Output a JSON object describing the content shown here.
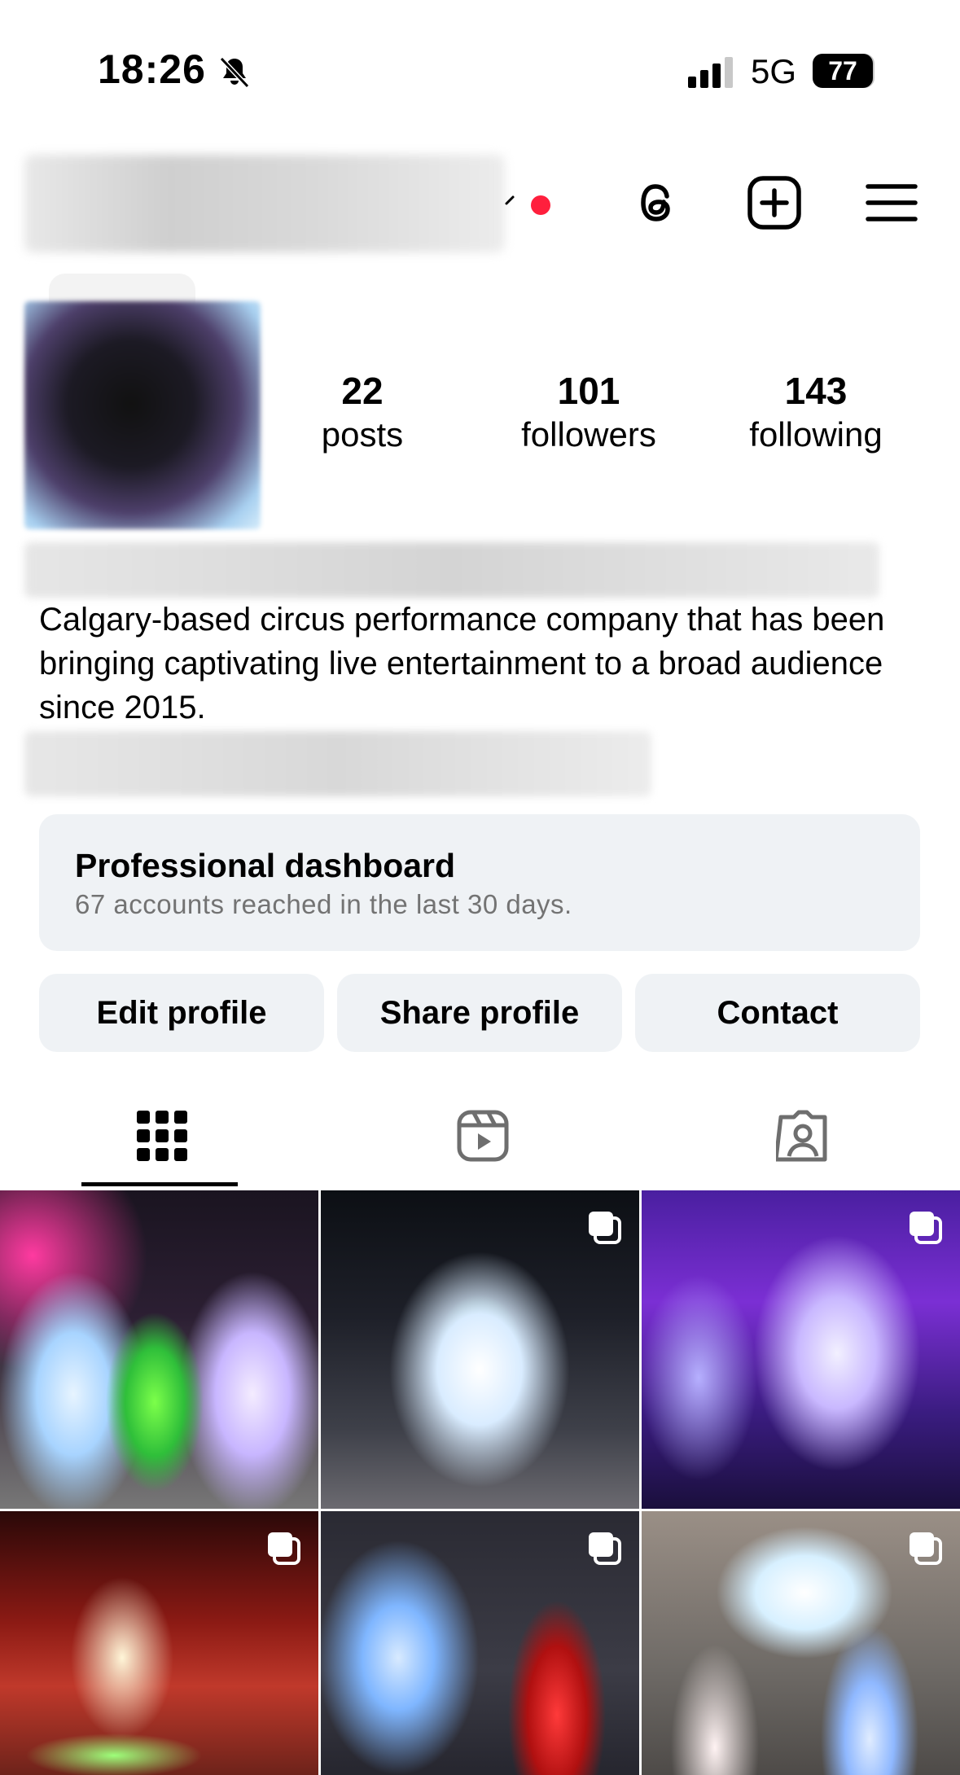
{
  "status_bar": {
    "time": "18:26",
    "network": "5G",
    "battery": "77"
  },
  "header": {
    "icons": [
      "threads-icon",
      "create-icon",
      "menu-icon"
    ]
  },
  "profile": {
    "stats": [
      {
        "value": "22",
        "label": "posts"
      },
      {
        "value": "101",
        "label": "followers"
      },
      {
        "value": "143",
        "label": "following"
      }
    ],
    "bio": "Calgary-based circus performance company that has been bringing captivating live entertainment to a broad audience since 2015."
  },
  "dashboard": {
    "title": "Professional dashboard",
    "subtitle": "67 accounts reached in the last 30 days."
  },
  "actions": {
    "edit": "Edit profile",
    "share": "Share profile",
    "contact": "Contact"
  },
  "tabs": [
    "grid-icon",
    "reels-icon",
    "tagged-icon"
  ],
  "colors": {
    "notification_dot": "#ff1f3d",
    "button_bg": "#eff2f5",
    "secondary_text": "#737373"
  }
}
